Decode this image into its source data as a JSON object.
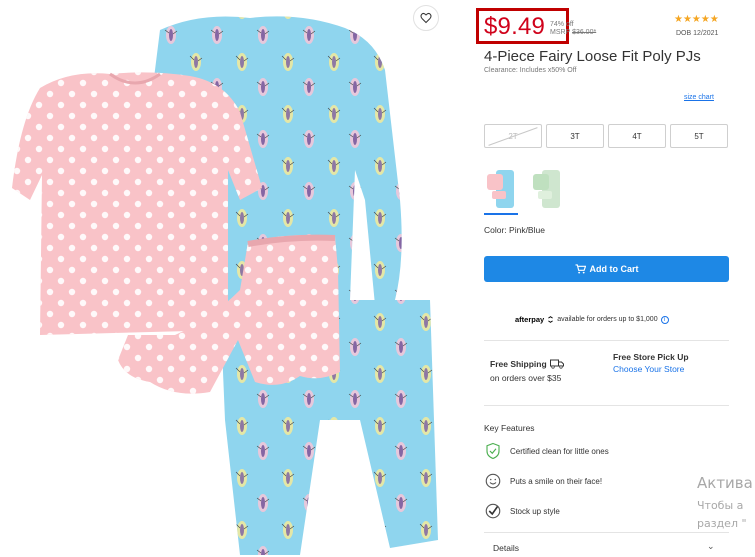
{
  "product": {
    "price": "$9.49",
    "discount": "74% off",
    "msrp_label": "MSRP",
    "msrp_value": "$36.00*",
    "rating_stars": "★★★★★",
    "dob": "DOB 12/2021",
    "title": "4-Piece Fairy Loose Fit Poly PJs",
    "subtitle": "Clearance: Includes x50% Off"
  },
  "size_chart_link": "size chart",
  "sizes": [
    {
      "label": "2T",
      "available": false
    },
    {
      "label": "3T",
      "available": true
    },
    {
      "label": "4T",
      "available": true
    },
    {
      "label": "5T",
      "available": true
    }
  ],
  "color": {
    "label": "Color: Pink/Blue",
    "options": [
      "Pink/Blue",
      "Green"
    ]
  },
  "add_to_cart": "Add to Cart",
  "afterpay": {
    "brand": "afterpay",
    "text": "available for orders up to $1,000",
    "info": "i"
  },
  "shipping": {
    "free_shipping": "Free Shipping",
    "free_shipping_sub": "on orders over $35",
    "store_pickup": "Free Store Pick Up",
    "choose_store": "Choose Your Store"
  },
  "key_features": {
    "title": "Key Features",
    "items": [
      {
        "icon": "leaf-shield-icon",
        "text": "Certified clean for little ones"
      },
      {
        "icon": "smile-icon",
        "text": "Puts a smile on their face!"
      },
      {
        "icon": "check-icon",
        "text": "Stock up style"
      }
    ]
  },
  "details": "Details",
  "watermark": {
    "line1": "Актива",
    "line2": "Чтобы а",
    "line3": "раздел \""
  },
  "colors": {
    "price_red": "#d0021b",
    "accent_blue": "#1e88e5",
    "star": "#f5a623",
    "pajama_blue": "#8dd3ec",
    "pajama_pink": "#f9c3c8"
  }
}
